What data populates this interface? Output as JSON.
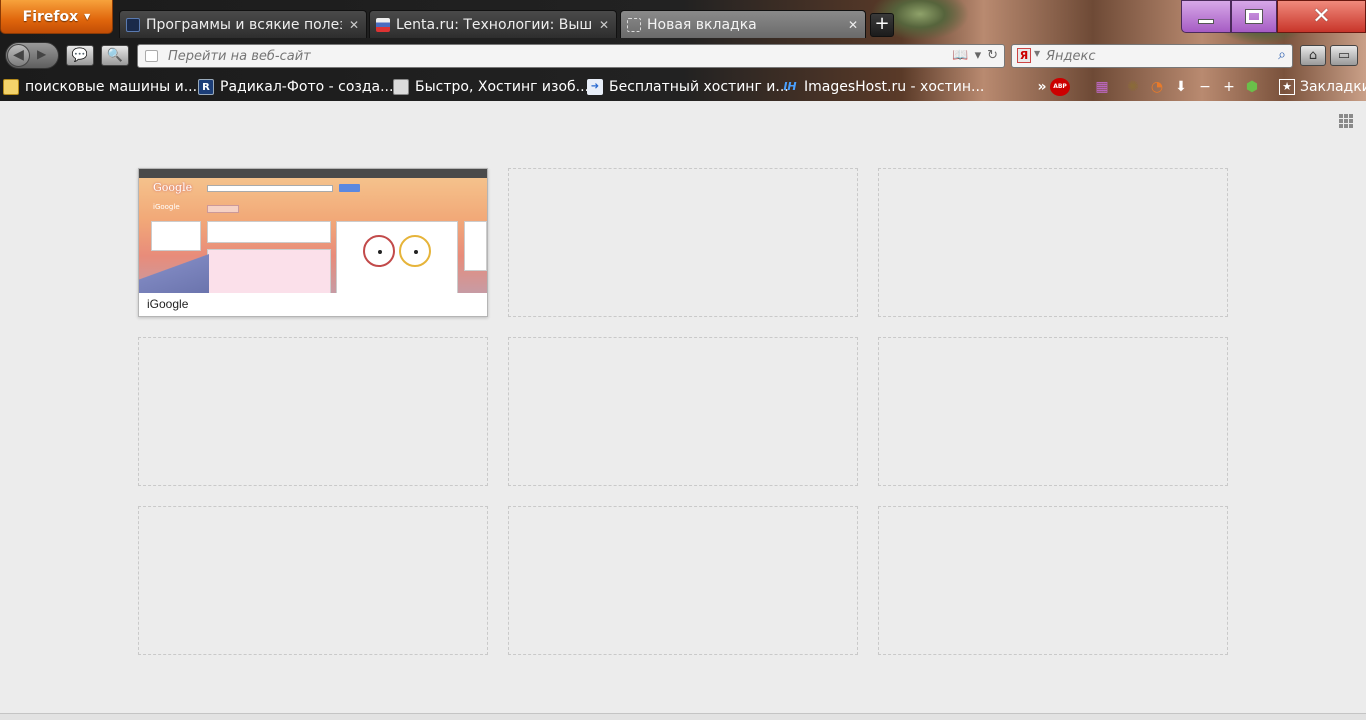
{
  "app": {
    "menu_button_label": "Firefox"
  },
  "tabs": [
    {
      "title": "Программы и всякие полез...",
      "active": false,
      "favicon_color": "#1a2a4a"
    },
    {
      "title": "Lenta.ru: Технологии: Вышел...",
      "active": false,
      "favicon_color": "#7a5a7a"
    },
    {
      "title": "Новая вкладка",
      "active": true,
      "favicon_color": "#cfcfcf"
    }
  ],
  "navbar": {
    "url_placeholder": "Перейти на веб-сайт",
    "search_placeholder": "Яндекс",
    "search_engine_glyph": "Я"
  },
  "bookmarks": [
    {
      "label": "поисковые машины и...",
      "icon": "folder-icon",
      "icon_color": "#f3d36b",
      "glyph": ""
    },
    {
      "label": "Радикал-Фото - созда...",
      "icon": "radikal-icon",
      "icon_color": "#1c3e78",
      "glyph": "R"
    },
    {
      "label": "Быстро, Хостинг изоб...",
      "icon": "pages-icon",
      "icon_color": "#dcdcdc",
      "glyph": ""
    },
    {
      "label": "Бесплатный хостинг и...",
      "icon": "arrow-icon",
      "icon_color": "#e8eef8",
      "glyph": "➜"
    },
    {
      "label": "ImagesHost.ru - хостин...",
      "icon": "imageshost-icon",
      "icon_color": "transparent",
      "glyph": "IH"
    }
  ],
  "toolbar": {
    "overflow_glyph": "»",
    "adblock_label": "ABP",
    "bookmarks_menu_label": "Закладки"
  },
  "newtab": {
    "sites": [
      {
        "title": "iGoogle",
        "thumb_logo": "Google",
        "thumb_logo2": "iGoogle"
      }
    ],
    "empty_slots": 8
  }
}
